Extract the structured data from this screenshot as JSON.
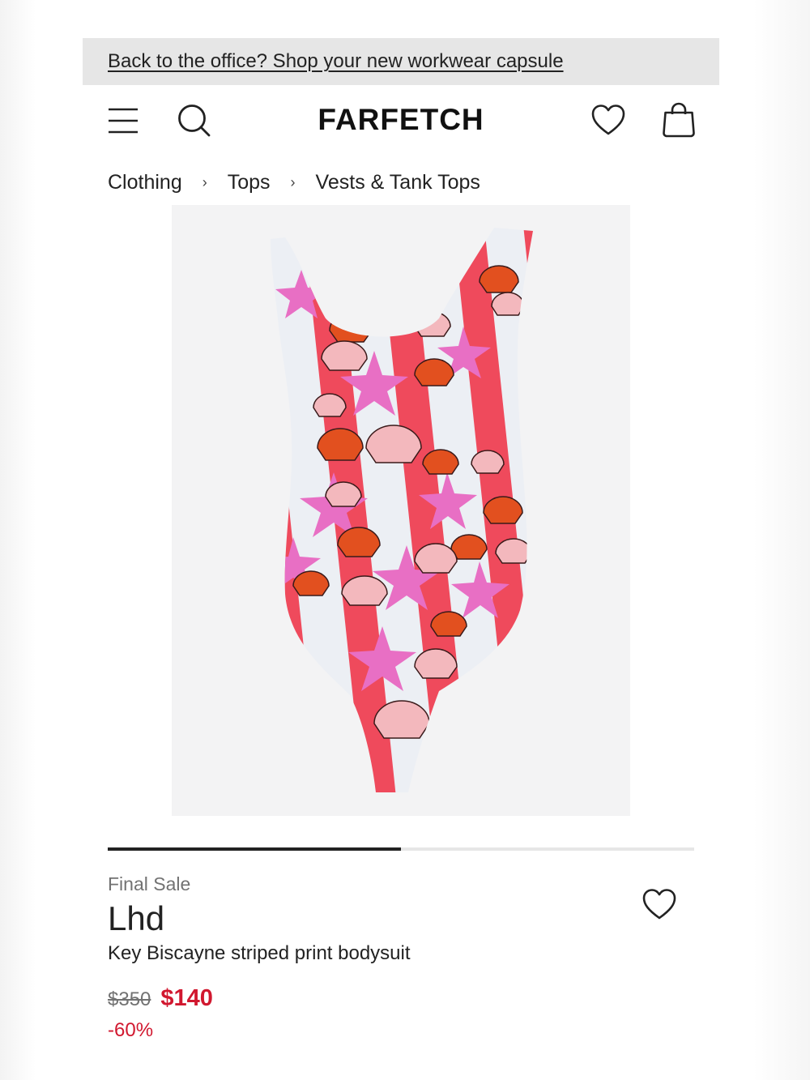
{
  "promo": {
    "text": "Back to the office? Shop your new workwear capsule"
  },
  "header": {
    "logo": "FARFETCH",
    "icons": [
      "menu-icon",
      "search-icon",
      "heart-icon",
      "shopping-bag-icon"
    ]
  },
  "breadcrumb": {
    "items": [
      "Clothing",
      "Tops",
      "Vests & Tank Tops"
    ],
    "separator": "›"
  },
  "product": {
    "sale_label": "Final Sale",
    "brand": "Lhd",
    "title": "Key Biscayne striped print bodysuit",
    "price_original": "$350",
    "price_sale": "$140",
    "discount": "-60%",
    "image_progress": 0.5
  },
  "colors": {
    "accent_sale": "#d1182f",
    "text": "#222222",
    "muted": "#727272",
    "banner_bg": "#e6e6e6",
    "print_red": "#ef4a5c",
    "print_pink": "#e86fc4",
    "print_orange": "#e2501f"
  }
}
